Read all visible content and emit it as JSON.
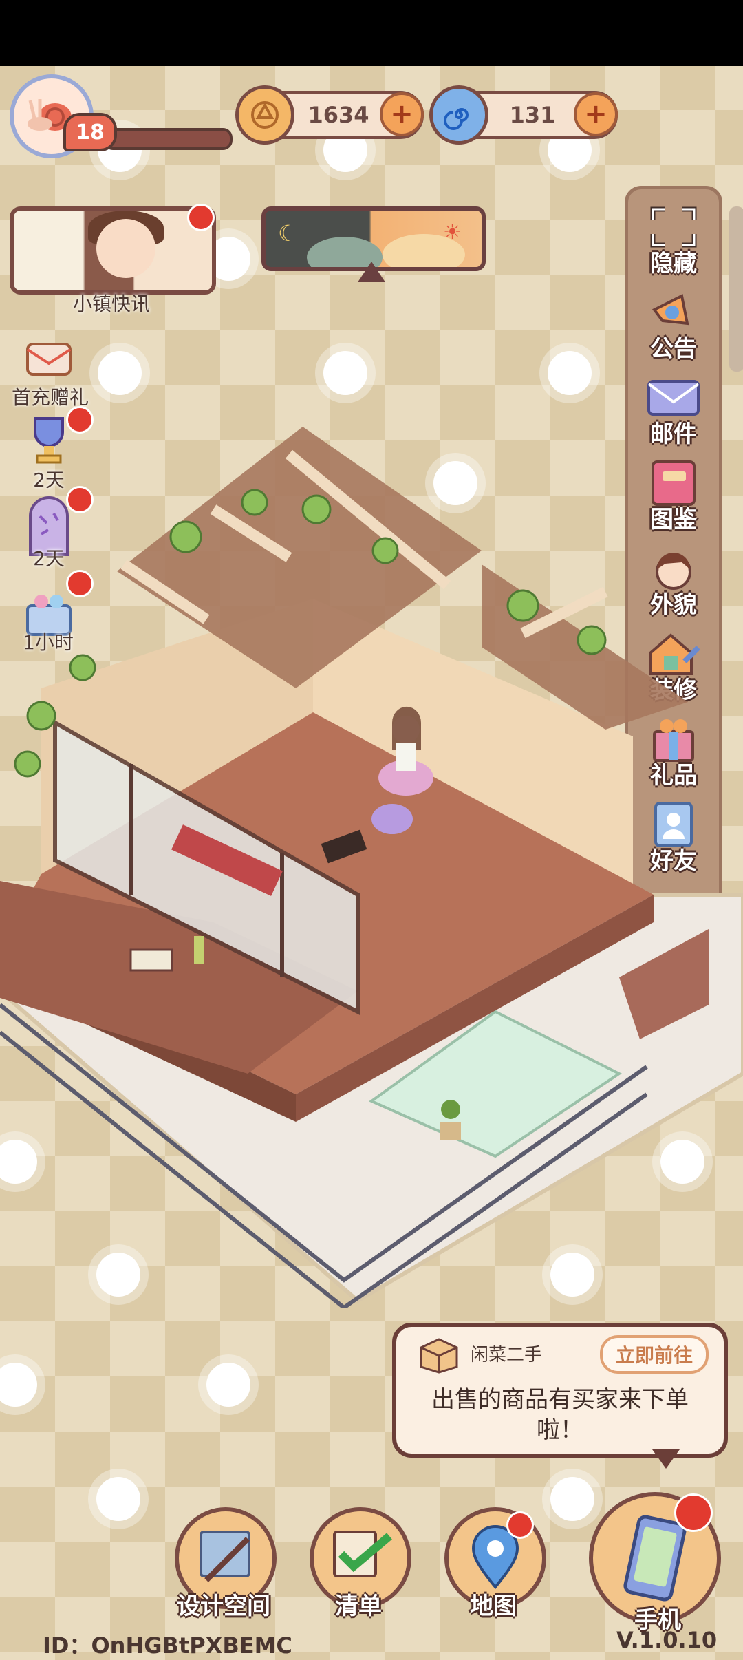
{
  "player": {
    "level": "18"
  },
  "currency": {
    "coins": "1634",
    "gems": "131"
  },
  "news": {
    "label": "小镇快讯"
  },
  "left_events": [
    {
      "label": "首充赠礼"
    },
    {
      "label": "2天"
    },
    {
      "label": "2天"
    },
    {
      "label": "1小时"
    }
  ],
  "right_menu": [
    {
      "label": "隐藏",
      "icon": "fullscreen-icon"
    },
    {
      "label": "公告",
      "icon": "megaphone-icon"
    },
    {
      "label": "邮件",
      "icon": "envelope-icon"
    },
    {
      "label": "图鉴",
      "icon": "book-icon"
    },
    {
      "label": "外貌",
      "icon": "character-face-icon"
    },
    {
      "label": "装修",
      "icon": "house-wrench-icon"
    },
    {
      "label": "礼品",
      "icon": "gift-icon"
    },
    {
      "label": "好友",
      "icon": "contacts-icon"
    }
  ],
  "notification": {
    "source": "闲菜二手",
    "button": "立即前往",
    "message": "出售的商品有买家来下单啦！"
  },
  "bottom_nav": {
    "design": "设计空间",
    "list": "清单",
    "map": "地图",
    "phone": "手机"
  },
  "footer": {
    "id": "ID：OnHGBtPXBEMC",
    "version": "V.1.0.10"
  }
}
